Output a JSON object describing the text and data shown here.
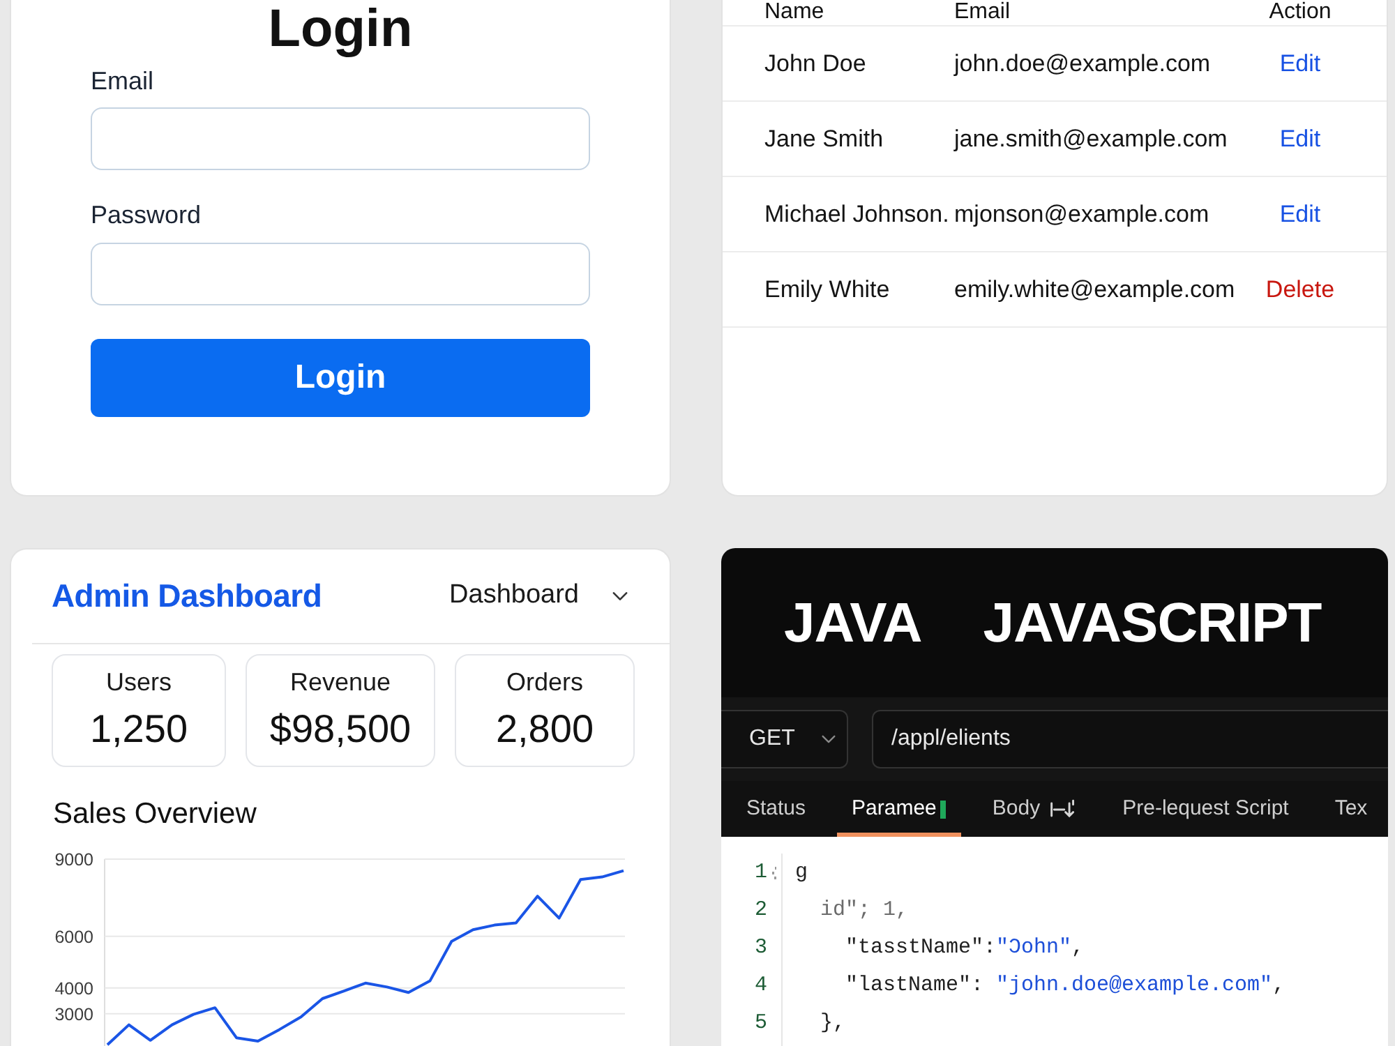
{
  "login_form": {
    "title": "Login",
    "fields": [
      {
        "label": "Email"
      },
      {
        "label": "Password"
      }
    ],
    "submit": "Login"
  },
  "users_table": {
    "columns": [
      "Name",
      "Email",
      "Action"
    ],
    "rows": [
      {
        "name": "John Doe",
        "email": "john.doe@example.com",
        "action": {
          "label": "Edit",
          "kind": "edit"
        }
      },
      {
        "name": "Jane Smith",
        "email": "jane.smith@example.com",
        "action": {
          "label": "Edit",
          "kind": "edit"
        }
      },
      {
        "name": "Michael Johnson.",
        "email": "mjonson@example.com",
        "action": {
          "label": "Edit",
          "kind": "edit"
        }
      },
      {
        "name": "Emily White",
        "email": "emily.white@example.com",
        "action": {
          "label": "Delete",
          "kind": "delete"
        }
      }
    ]
  },
  "dashboard": {
    "title": "Admin Dashboard",
    "view_select": "Dashboard",
    "stats": [
      {
        "label": "Users",
        "value": "1,250"
      },
      {
        "label": "Revenue",
        "value": "$98,500"
      },
      {
        "label": "Orders",
        "value": "2,800"
      }
    ],
    "sales_chart": {
      "chart_data": {
        "type": "line",
        "title": "Sales Overview",
        "categories": [
          null,
          null,
          null,
          null,
          null,
          null,
          null,
          null,
          null,
          null,
          null,
          null,
          null,
          null,
          null,
          null,
          null,
          null,
          null,
          null,
          null,
          null,
          null,
          null,
          null
        ],
        "ylim": [
          1750,
          9000
        ],
        "yticks": [
          9000,
          6000,
          4000,
          3000
        ],
        "grid": true,
        "series": [
          {
            "color": "#1a55e6",
            "values": [
              1800,
              2570,
              1970,
              2570,
              2980,
              3230,
              2070,
              1940,
              2390,
              2880,
              3590,
              3880,
              4190,
              4040,
              3830,
              4280,
              5810,
              6260,
              6440,
              6530,
              7560,
              6710,
              8210,
              8310,
              8550
            ]
          }
        ]
      }
    }
  },
  "api_client": {
    "languages": [
      "JAVA",
      "JAVASCRIPT"
    ],
    "method": "GET",
    "url": "/appl/elients",
    "tabs": [
      {
        "label": "Status",
        "selected": false,
        "kind": "plain"
      },
      {
        "label": "Paramee",
        "selected": true,
        "kind": "marked"
      },
      {
        "label": "Body",
        "selected": false,
        "kind": "glyph"
      },
      {
        "label": "Pre-lequest Script",
        "selected": false,
        "kind": "plain"
      },
      {
        "label": "Tex",
        "selected": false,
        "kind": "plain"
      }
    ],
    "code_lines": [
      {
        "number": "1",
        "collapsible": true,
        "segments": [
          {
            "text": "g",
            "kind": "plain"
          }
        ]
      },
      {
        "number": "2",
        "collapsible": false,
        "segments": [
          {
            "text": "  id\"; 1,",
            "kind": "faded"
          }
        ]
      },
      {
        "number": "3",
        "collapsible": false,
        "segments": [
          {
            "text": "    \"tasstName\":",
            "kind": "plain"
          },
          {
            "text": "\"Ɔohn\"",
            "kind": "string"
          },
          {
            "text": ",",
            "kind": "plain"
          }
        ]
      },
      {
        "number": "4",
        "collapsible": false,
        "segments": [
          {
            "text": "    \"lastName\": ",
            "kind": "plain"
          },
          {
            "text": "\"john.doe@example.com\"",
            "kind": "string"
          },
          {
            "text": ",",
            "kind": "plain"
          }
        ]
      },
      {
        "number": "5",
        "collapsible": false,
        "segments": [
          {
            "text": "  },",
            "kind": "plain"
          }
        ]
      }
    ]
  }
}
